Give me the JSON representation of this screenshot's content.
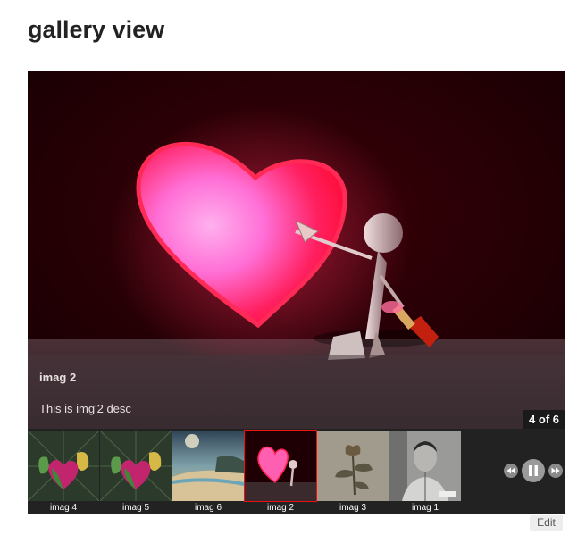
{
  "page": {
    "title": "gallery view"
  },
  "gallery": {
    "current": {
      "title": "imag 2",
      "description": "This is img'2 desc"
    },
    "counter": "4 of 6",
    "thumbnails": [
      {
        "label": "imag 4",
        "active": false
      },
      {
        "label": "imag 5",
        "active": false
      },
      {
        "label": "imag 6",
        "active": false
      },
      {
        "label": "imag 2",
        "active": true
      },
      {
        "label": "imag 3",
        "active": false
      },
      {
        "label": "imag 1",
        "active": false
      }
    ],
    "controls": {
      "prev_icon": "rewind-icon",
      "pause_icon": "pause-icon",
      "next_icon": "fast-forward-icon"
    }
  },
  "footer": {
    "edit_label": "Edit"
  }
}
